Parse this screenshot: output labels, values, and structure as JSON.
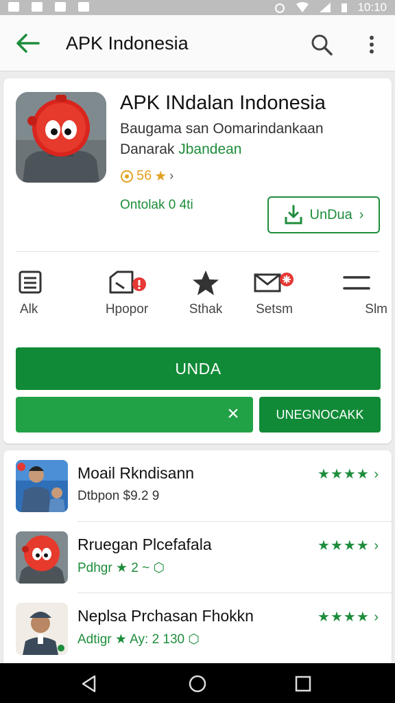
{
  "status_bar": {
    "time": "10:10"
  },
  "app_bar": {
    "title": "APK Indonesia"
  },
  "app": {
    "title": "APK INdalan Indonesia",
    "subtitle": "Baugama san Oomarindankaan",
    "developer_prefix": "Danarak",
    "developer_name": "Jbandean",
    "rating": "56",
    "meta": "Ontolak 0 4ti",
    "install_label": "UnDua"
  },
  "actions": [
    {
      "label": "Alk"
    },
    {
      "label": "Hpopor"
    },
    {
      "label": "Sthak"
    },
    {
      "label": "Setsm"
    },
    {
      "label": "Slm"
    }
  ],
  "buttons": {
    "primary_label": "UNDA",
    "progress_close": "×",
    "secondary_label": "UNEGNOCAKK",
    "progress_fraction": 1.0
  },
  "list": [
    {
      "name": "Moail Rkndisann",
      "sub": "Dtbpon $9.2 9",
      "stars": "★★★★",
      "sub_color": "dark"
    },
    {
      "name": "Rruegan Plcefafala",
      "sub": "Pdhgr ★ 2 ~ ⬡",
      "stars": "★★★★",
      "sub_color": "green"
    },
    {
      "name": "Neplsa Prchasan Fhokkn",
      "sub": "Adtigr ★ Ay: 2 130 ⬡",
      "stars": "★★★★",
      "sub_color": "green"
    }
  ],
  "colors": {
    "accent": "#1d8d3b",
    "primary_button": "#108a37",
    "progress": "#21a247",
    "rating_star": "#e0a222"
  },
  "icons": [
    "back-arrow-icon",
    "search-icon",
    "more-vert-icon",
    "list-icon",
    "report-icon",
    "star-icon",
    "mail-icon",
    "menu-icon",
    "download-icon",
    "close-icon",
    "nav-back-icon",
    "nav-home-icon",
    "nav-recents-icon"
  ]
}
